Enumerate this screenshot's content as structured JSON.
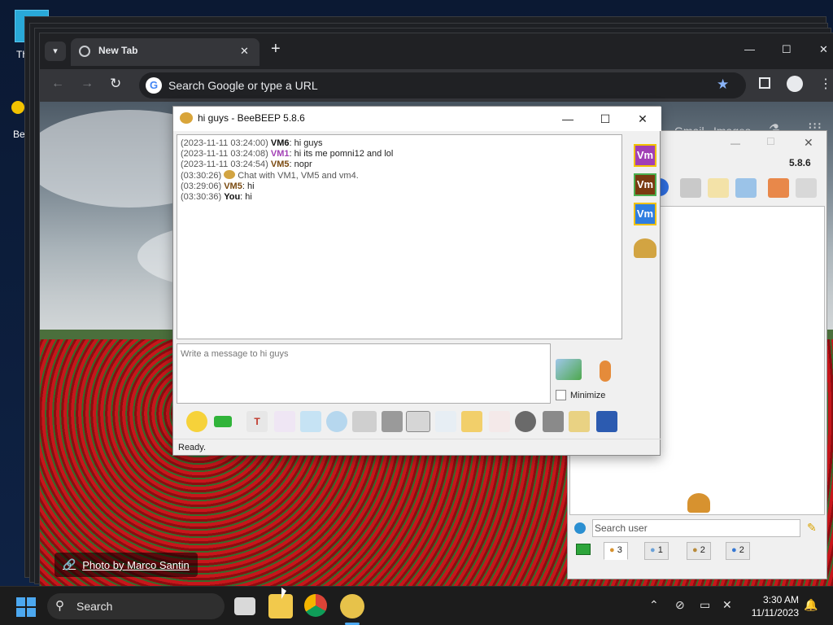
{
  "desktop": {
    "icons": [
      {
        "label": "Th"
      },
      {
        "label": "Be"
      }
    ]
  },
  "chrome": {
    "tab_title": "New Tab",
    "new_tab": "+",
    "omnibox_placeholder": "Search Google or type a URL",
    "google_links": [
      "Gmail",
      "Images"
    ],
    "photo_credit": "Photo by Marco Santin",
    "window_controls": {
      "minimize": "—",
      "maximize": "☐",
      "close": "✕"
    }
  },
  "beebeep_main": {
    "version": "5.8.6",
    "search_placeholder": "Search user",
    "tabs": [
      {
        "icon": "users-icon",
        "count": "3"
      },
      {
        "icon": "chat-icon",
        "count": "1"
      },
      {
        "icon": "groups-icon",
        "count": "2"
      },
      {
        "icon": "shares-icon",
        "count": "2"
      }
    ]
  },
  "chat": {
    "title": "hi guys - BeeBEEP 5.8.6",
    "messages": [
      {
        "ts": "(2023-11-11 03:24:00)",
        "user": "VM6",
        "user_color": "#111111",
        "text": " hi guys"
      },
      {
        "ts": "(2023-11-11 03:24:08)",
        "user": "VM1",
        "user_color": "#a13fb5",
        "text": " hi its me pomni12 and lol"
      },
      {
        "ts": "(2023-11-11 03:24:54)",
        "user": "VM5",
        "user_color": "#7a4a10",
        "text": " nopr"
      },
      {
        "ts": "(03:30:26)",
        "user": "",
        "user_color": "#555555",
        "text": "Chat with VM1, VM5 and vm4.",
        "system": true
      },
      {
        "ts": "(03:29:06)",
        "user": "VM5",
        "user_color": "#7a4a10",
        "text": " hi"
      },
      {
        "ts": "(03:30:36)",
        "user": "You",
        "user_color": "#111111",
        "text": " hi"
      }
    ],
    "input_placeholder": "Write a message to hi guys",
    "minimize_label": "Minimize",
    "status": "Ready.",
    "members": [
      {
        "label": "Vm",
        "bg": "#a13fb5",
        "border": "#f2c200"
      },
      {
        "label": "Vm",
        "bg": "#7a3a10",
        "border": "#4caf50"
      },
      {
        "label": "Vm",
        "bg": "#2f7de0",
        "border": "#f2c200"
      }
    ]
  },
  "taskbar": {
    "search_label": "Search",
    "time": "3:30 AM",
    "date": "11/11/2023"
  }
}
